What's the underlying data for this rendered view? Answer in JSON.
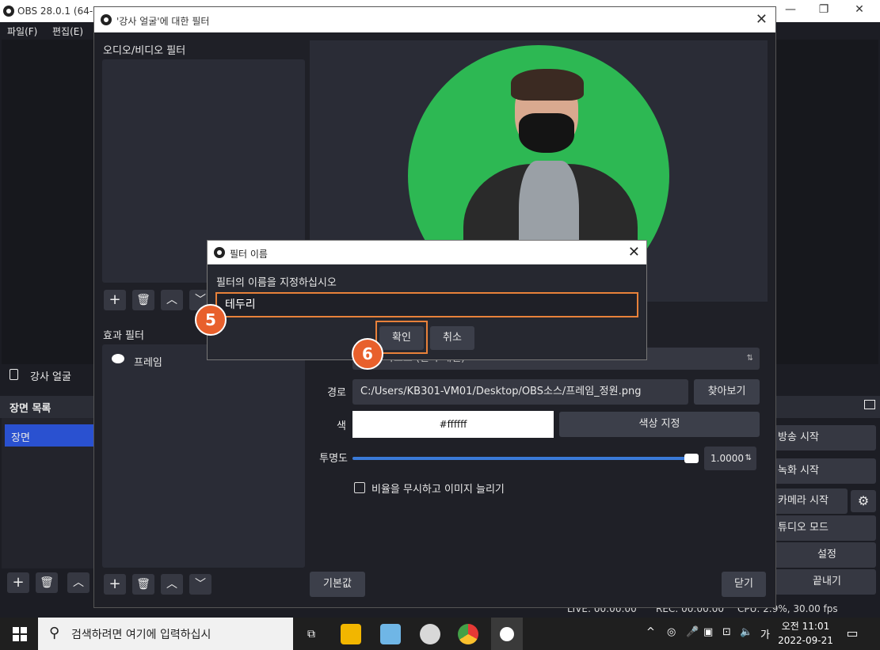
{
  "obs_main": {
    "title": "OBS 28.0.1 (64-b",
    "menu": [
      "파일(F)",
      "편집(E)"
    ],
    "window_controls": [
      "—",
      "❐",
      "✕"
    ],
    "source_item": "강사 얼굴",
    "scene_header": "장면 목록",
    "scene_item": "장면",
    "controls": {
      "stream": "방송 시작",
      "record": "녹화 시작",
      "camera": "카메라 시작",
      "studio": "튜디오 모드",
      "settings": "설정",
      "exit": "끝내기"
    },
    "status": {
      "live": "LIVE: 00:00:00",
      "rec": "REC: 00:00:00",
      "cpu": "CPU: 2.9%, 30.00 fps"
    }
  },
  "filters_window": {
    "title": "'강사 얼굴'에 대한 필터",
    "audio_video_label": "오디오/비디오 필터",
    "effects_label": "효과 필터",
    "effect_items": [
      "프레임"
    ],
    "properties": {
      "path_label": "경로",
      "path_value": "C:/Users/KB301-VM01/Desktop/OBS소스/프레임_정원.png",
      "browse_label": "찾아보기",
      "color_label": "색",
      "color_value": "#ffffff",
      "color_pick_label": "색상 지정",
      "opacity_label": "투명도",
      "opacity_value": "1.0000",
      "stretch_label": "비율을 무시하고 이미지 늘리기",
      "type_partial": "마스크 (알파 채널)"
    },
    "defaults_label": "기본값",
    "close_label": "닫기"
  },
  "name_dialog": {
    "title": "필터 이름",
    "prompt": "필터의 이름을 지정하십시오",
    "input_value": "테두리",
    "ok_label": "확인",
    "cancel_label": "취소"
  },
  "steps": [
    "5",
    "6"
  ],
  "taskbar": {
    "search_placeholder": "검색하려면 여기에 입력하십시",
    "tray_lang": "가",
    "time": "오전 11:01",
    "date": "2022-09-21"
  },
  "colors": {
    "accent_orange": "#e8813a",
    "badge": "#e8602c",
    "chroma_green": "#2db853",
    "scene_blue": "#2a51d0"
  }
}
